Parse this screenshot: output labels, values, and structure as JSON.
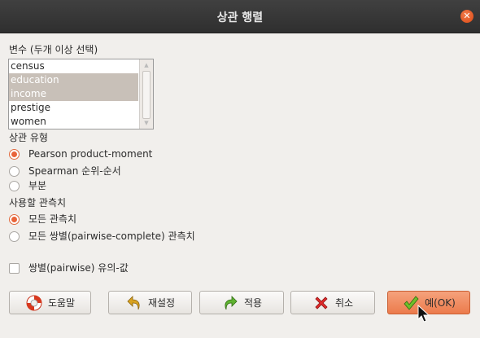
{
  "window": {
    "title": "상관 행렬",
    "close_symbol": "✕"
  },
  "variables": {
    "label": "변수 (두개 이상 선택)",
    "items": [
      {
        "label": "census",
        "selected": false
      },
      {
        "label": "education",
        "selected": true
      },
      {
        "label": "income",
        "selected": true
      },
      {
        "label": "prestige",
        "selected": false
      },
      {
        "label": "women",
        "selected": false
      }
    ]
  },
  "correlation_type": {
    "label": "상관 유형",
    "options": [
      {
        "label": "Pearson product-moment",
        "checked": true
      },
      {
        "label": "Spearman 순위-순서",
        "checked": false
      },
      {
        "label": "부분",
        "checked": false
      }
    ]
  },
  "observations": {
    "label": "사용할 관측치",
    "options": [
      {
        "label": "모든 관측치",
        "checked": true
      },
      {
        "label": "모든 쌍별(pairwise-complete) 관측치",
        "checked": false
      }
    ]
  },
  "pairwise_pvalues": {
    "label": "쌍별(pairwise) 유의-값",
    "checked": false
  },
  "buttons": {
    "help": "도움말",
    "reset": "재설정",
    "apply": "적용",
    "cancel": "취소",
    "ok": "예(OK)"
  },
  "colors": {
    "accent": "#e9643a",
    "titlebar": "#3a3a3a",
    "selection": "#c8c0b8"
  }
}
